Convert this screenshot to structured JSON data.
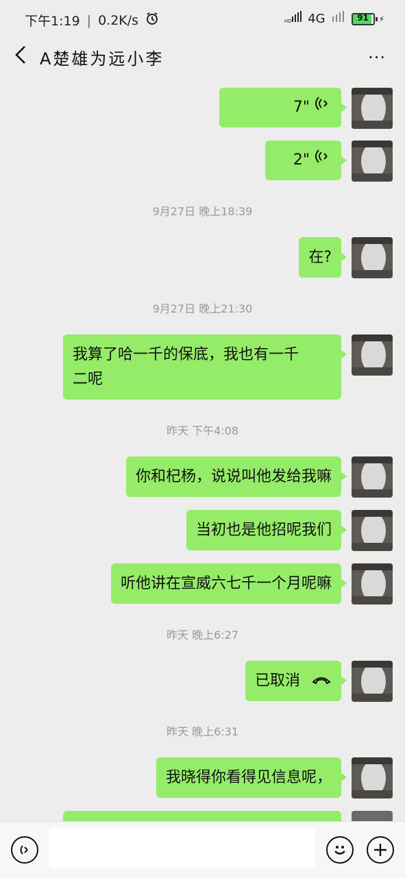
{
  "status": {
    "time": "下午1:19",
    "speed": "0.2K/s",
    "network": "4G",
    "battery": "91"
  },
  "header": {
    "title": "A楚雄为远小李",
    "more": "···"
  },
  "messages": [
    {
      "type": "voice",
      "duration": "7\""
    },
    {
      "type": "voice",
      "duration": "2\""
    },
    {
      "type": "time",
      "text": "9月27日 晚上18:39"
    },
    {
      "type": "text",
      "text": "在?"
    },
    {
      "type": "time",
      "text": "9月27日 晚上21:30"
    },
    {
      "type": "text",
      "line1": "我算了哈一千的保底，我也有一千",
      "line2": "二呢"
    },
    {
      "type": "time",
      "text": "昨天 下午4:08"
    },
    {
      "type": "text",
      "text": "你和杞杨，说说叫他发给我嘛"
    },
    {
      "type": "text",
      "text": "当初也是他招呢我们"
    },
    {
      "type": "text",
      "text": "听他讲在宣威六七千一个月呢嘛"
    },
    {
      "type": "time",
      "text": "昨天 晚上6:27"
    },
    {
      "type": "call",
      "text": "已取消"
    },
    {
      "type": "time",
      "text": "昨天 晚上6:31"
    },
    {
      "type": "text",
      "text": "我晓得你看得见信息呢，"
    }
  ],
  "colors": {
    "bubble": "#95ec69",
    "background": "#ededed"
  },
  "icons": [
    "back-arrow-icon",
    "more-icon",
    "voice-mode-icon",
    "emoji-icon",
    "plus-icon",
    "voice-wave-icon",
    "phone-hangup-icon"
  ]
}
